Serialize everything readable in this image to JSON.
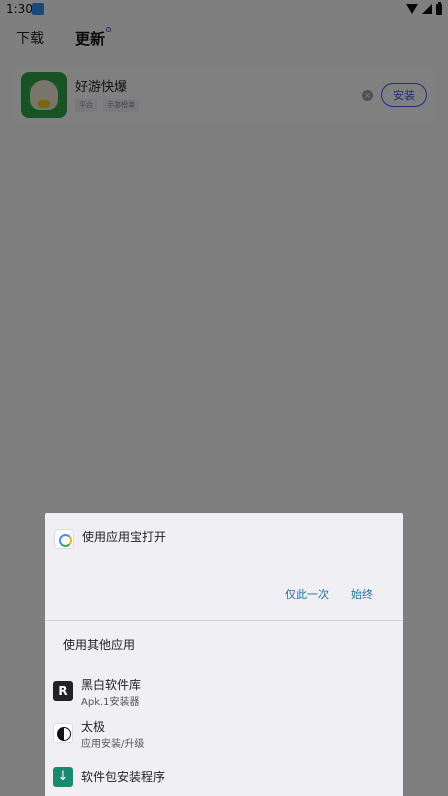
{
  "status_bar": {
    "time": "1:30"
  },
  "tabs": [
    {
      "label": "下载"
    },
    {
      "label": "更新"
    }
  ],
  "update_item": {
    "name": "好游快爆",
    "tags": [
      "平台",
      "手游榜单"
    ],
    "action_label": "安装"
  },
  "chooser": {
    "open_with": "使用应用宝打开",
    "once_label": "仅此一次",
    "always_label": "始终",
    "other_apps_heading": "使用其他应用",
    "options": [
      {
        "title": "黑白软件库",
        "subtitle": "Apk.1安装器",
        "icon": "heibai-logo-icon"
      },
      {
        "title": "太极",
        "subtitle": "应用安装/升级",
        "icon": "taiji-icon"
      },
      {
        "title": "软件包安装程序",
        "subtitle": "",
        "icon": "package-installer-icon"
      }
    ]
  },
  "colors": {
    "accent": "#3d57e0",
    "dialog_button": "#1e6fa3",
    "sheet_background": "#f0eff3"
  }
}
